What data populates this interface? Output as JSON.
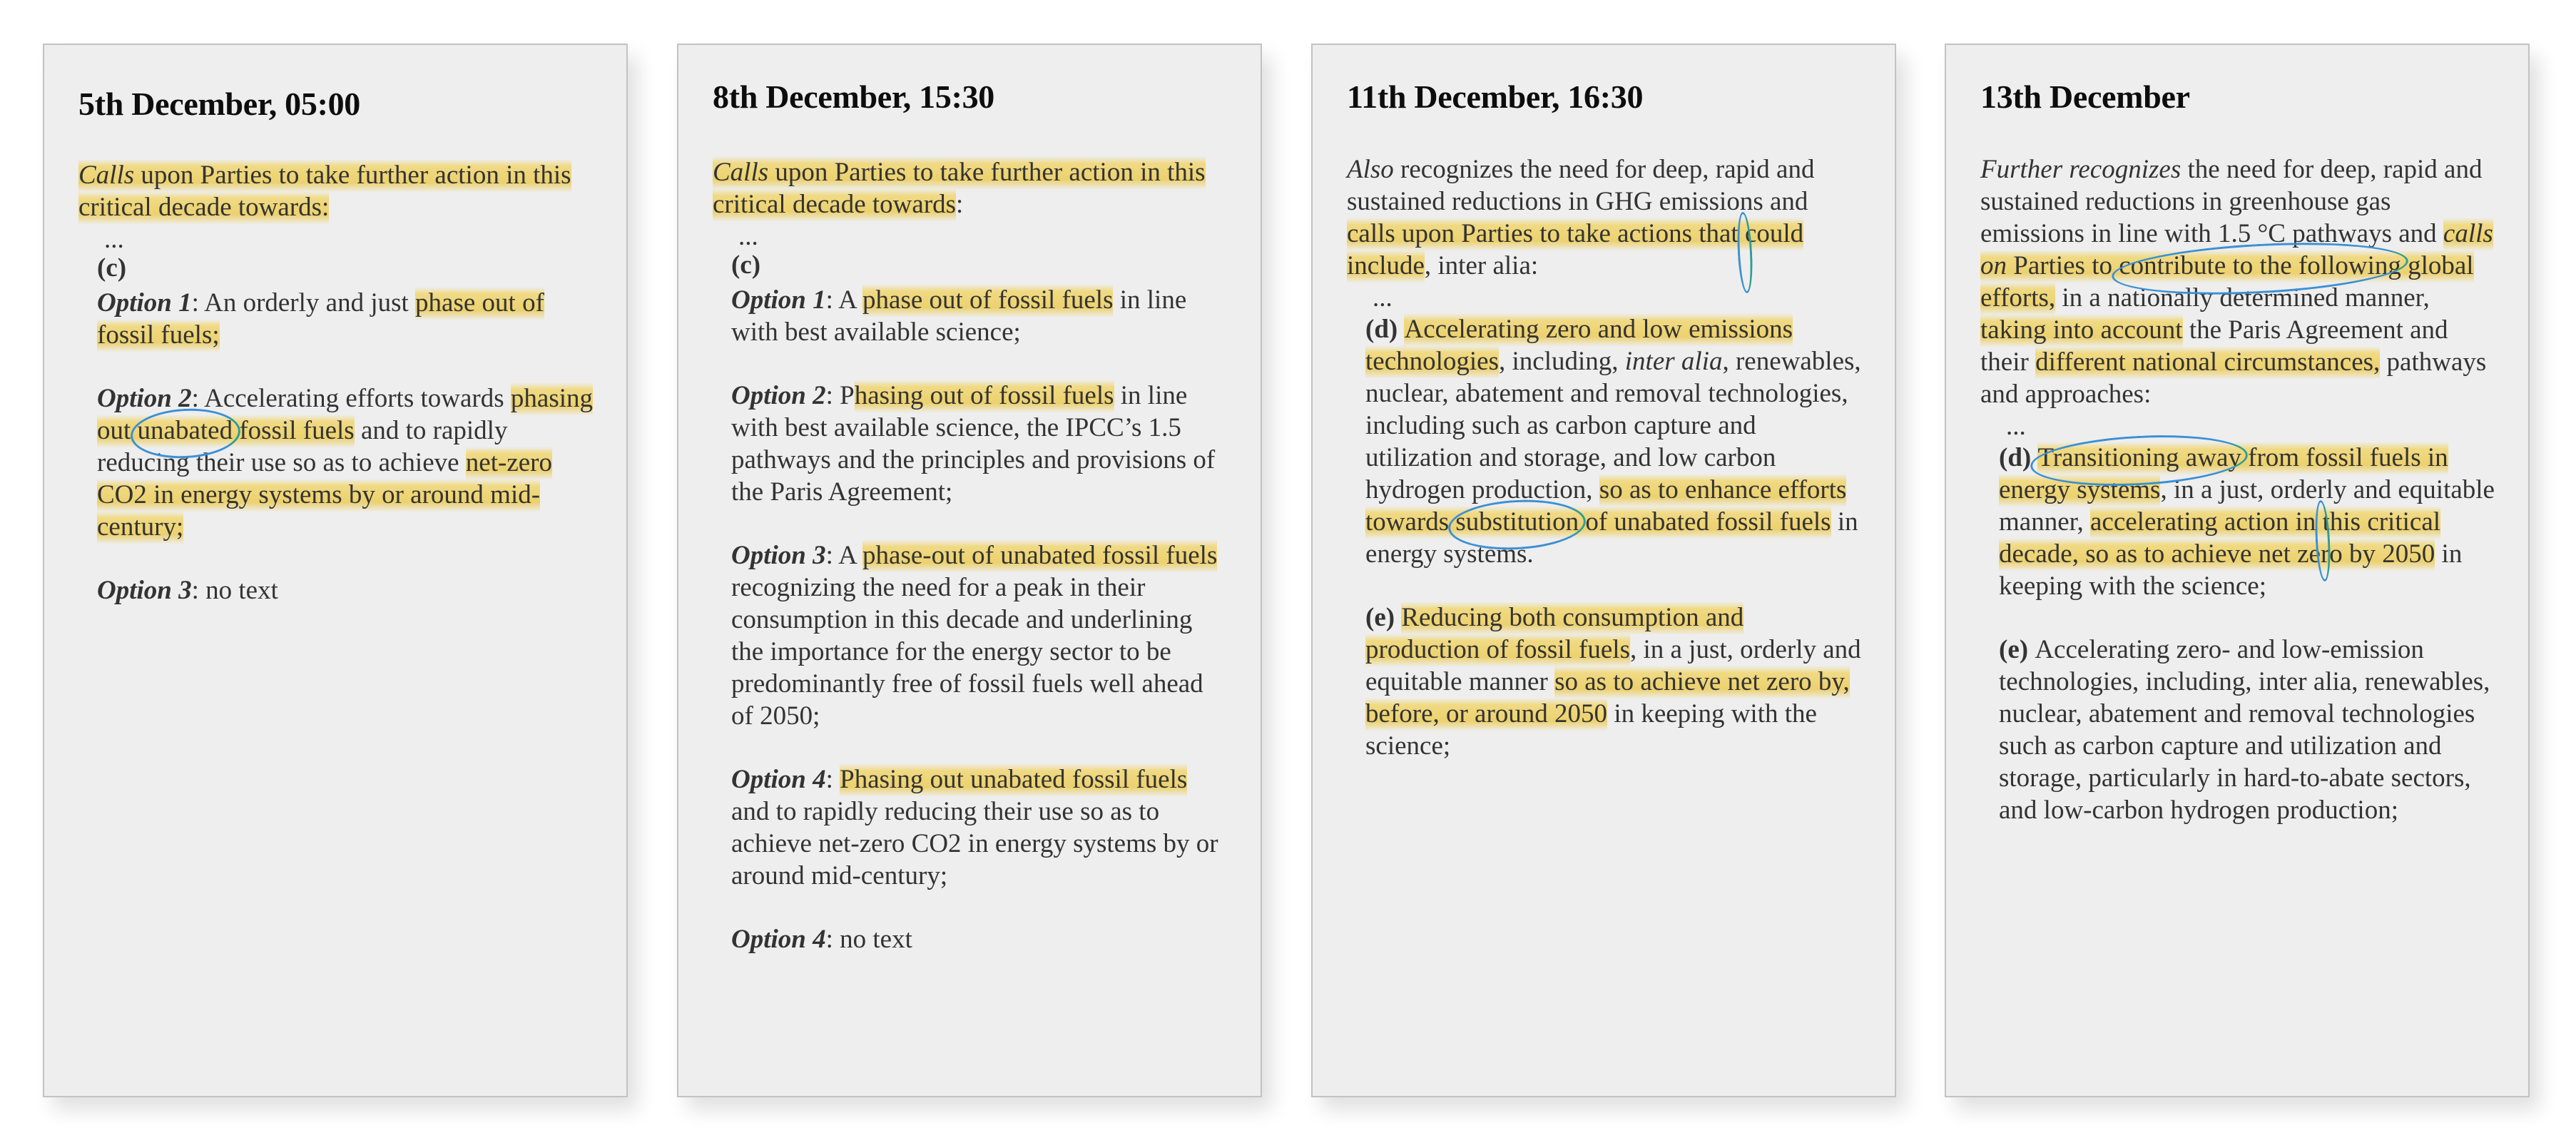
{
  "colors": {
    "card_background": "#eeeeee",
    "highlight": "#f0d670",
    "circle_annotation": "#3a90d4",
    "text": "#333333",
    "title": "#0d0d0d"
  },
  "cards": [
    {
      "title": "5th December, 05:00",
      "paragraphs": [
        {
          "kind": "lead",
          "segments": [
            {
              "t": "Calls",
              "i": true,
              "hl": true
            },
            {
              "t": " upon Parties to take further action in this critical decade towards:",
              "hl": true
            }
          ]
        },
        {
          "kind": "ellipsis",
          "segments": [
            {
              "t": "..."
            }
          ]
        },
        {
          "kind": "label",
          "segments": [
            {
              "t": "(c)",
              "b": true
            }
          ]
        },
        {
          "kind": "item",
          "gap": "s",
          "segments": [
            {
              "t": "Option 1",
              "bi": true
            },
            {
              "t": ": An orderly and just "
            },
            {
              "t": "phase out of fossil fuels;",
              "hl": true
            }
          ]
        },
        {
          "kind": "item",
          "segments": [
            {
              "t": "Option 2",
              "bi": true
            },
            {
              "t": ": Accelerating efforts towards "
            },
            {
              "t": "phasing out ",
              "hl": true
            },
            {
              "t": "unabated",
              "hl": true,
              "circle": true
            },
            {
              "t": " fossil fuels",
              "hl": true
            },
            {
              "t": " and to rapidly reducing their use so as to achieve "
            },
            {
              "t": "net-zero CO2 in energy systems by or around mid-century;",
              "hl": true
            }
          ]
        },
        {
          "kind": "item",
          "segments": [
            {
              "t": "Option 3",
              "bi": true
            },
            {
              "t": ": no text"
            }
          ]
        }
      ]
    },
    {
      "title": "8th December, 15:30",
      "paragraphs": [
        {
          "kind": "lead",
          "segments": [
            {
              "t": "Calls",
              "i": true,
              "hl": true
            },
            {
              "t": " upon Parties to take further action in this critical decade towards",
              "hl": true
            },
            {
              "t": ":"
            }
          ]
        },
        {
          "kind": "ellipsis",
          "segments": [
            {
              "t": "..."
            }
          ]
        },
        {
          "kind": "label",
          "segments": [
            {
              "t": "(c)",
              "b": true
            }
          ]
        },
        {
          "kind": "item",
          "gap": "s",
          "segments": [
            {
              "t": "Option 1",
              "bi": true
            },
            {
              "t": ": A "
            },
            {
              "t": "phase out of fossil fuels",
              "hl": true
            },
            {
              "t": " in line with best available science;"
            }
          ]
        },
        {
          "kind": "item",
          "segments": [
            {
              "t": "Option 2",
              "bi": true
            },
            {
              "t": ": P"
            },
            {
              "t": "hasing out of fossil fuels",
              "hl": true
            },
            {
              "t": " in line with best available science, the IPCC’s 1.5 pathways and the principles and provisions of the Paris Agreement;"
            }
          ]
        },
        {
          "kind": "item",
          "segments": [
            {
              "t": "Option 3",
              "bi": true
            },
            {
              "t": ": A "
            },
            {
              "t": "phase-out of unabated fossil fuels",
              "hl": true
            },
            {
              "t": " recognizing the need for a peak in their consumption in this decade and underlining the importance for the energy sector to be predominantly free of fossil fuels well ahead of 2050;"
            }
          ]
        },
        {
          "kind": "item",
          "segments": [
            {
              "t": "Option 4",
              "bi": true
            },
            {
              "t": ": "
            },
            {
              "t": "Phasing out unabated fossil fuels",
              "hl": true
            },
            {
              "t": " and to rapidly reducing their use so as to achieve net-zero CO2 in energy systems by or around mid-century;"
            }
          ]
        },
        {
          "kind": "item",
          "segments": [
            {
              "t": "Option 4",
              "bi": true
            },
            {
              "t": ": no text"
            }
          ]
        }
      ]
    },
    {
      "title": "11th December, 16:30",
      "paragraphs": [
        {
          "kind": "lead",
          "segments": [
            {
              "t": "Also",
              "i": true
            },
            {
              "t": " recognizes the need for deep, rapid and sustained reductions in GHG emissions and "
            },
            {
              "t": "calls upon Parties to take actions that ",
              "hl": true
            },
            {
              "t": "could include",
              "hl": true,
              "circle": true
            },
            {
              "t": ", inter alia:"
            }
          ]
        },
        {
          "kind": "ellipsis",
          "segments": [
            {
              "t": "..."
            }
          ]
        },
        {
          "kind": "item",
          "gap": "s",
          "segments": [
            {
              "t": "(d) ",
              "b": true
            },
            {
              "t": "Accelerating zero and low emissions technologies",
              "hl": true
            },
            {
              "t": ", including, "
            },
            {
              "t": "inter alia",
              "i": true
            },
            {
              "t": ", renewables, nuclear, abatement and removal technologies, including such as carbon capture and utilization and storage, and low carbon hydrogen production, "
            },
            {
              "t": "so as to enhance efforts towards ",
              "hl": true
            },
            {
              "t": "substitution",
              "hl": true,
              "circle": true
            },
            {
              "t": " of unabated fossil fuels",
              "hl": true
            },
            {
              "t": " in energy systems."
            }
          ]
        },
        {
          "kind": "item",
          "segments": [
            {
              "t": "(e) ",
              "b": true
            },
            {
              "t": "Reducing both consumption and production of fossil fuels",
              "hl": true
            },
            {
              "t": ", in a just, orderly and equitable manner "
            },
            {
              "t": "so as to achieve net zero by, before, or around 2050",
              "hl": true
            },
            {
              "t": " in keeping with the science;"
            }
          ]
        }
      ]
    },
    {
      "title": "13th December",
      "paragraphs": [
        {
          "kind": "lead",
          "segments": [
            {
              "t": "Further recognizes",
              "i": true
            },
            {
              "t": " the need for deep, rapid and sustained reductions in greenhouse gas emissions in line with 1.5 °C pathways and "
            },
            {
              "t": "calls on",
              "i": true,
              "hl": true
            },
            {
              "t": " Parties to ",
              "hl": true
            },
            {
              "t": "contribute to the following",
              "hl": true,
              "circle": true
            },
            {
              "t": " global efforts,",
              "hl": true
            },
            {
              "t": " in a nationally determined manner, "
            },
            {
              "t": "taking into account",
              "hl": true
            },
            {
              "t": " the Paris Agreement and their "
            },
            {
              "t": "different national circumstances,",
              "hl": true
            },
            {
              "t": " pathways and approaches:"
            }
          ]
        },
        {
          "kind": "ellipsis",
          "segments": [
            {
              "t": "..."
            }
          ]
        },
        {
          "kind": "item",
          "gap": "s",
          "segments": [
            {
              "t": "(d) ",
              "b": true
            },
            {
              "t": "Transitioning away",
              "hl": true,
              "circle": true
            },
            {
              "t": " from fossil fuels in energy systems",
              "hl": true
            },
            {
              "t": ", in a just, orderly and equitable manner, "
            },
            {
              "t": "accelerating action in ",
              "hl": true
            },
            {
              "t": "this critical decade,",
              "hl": true,
              "circle": true
            },
            {
              "t": " so as to achieve net zero by 2050",
              "hl": true
            },
            {
              "t": " in keeping with the science;"
            }
          ]
        },
        {
          "kind": "item",
          "segments": [
            {
              "t": "(e) ",
              "b": true
            },
            {
              "t": "Accelerating zero- and low-emission technologies, including, inter alia, renewables, nuclear, abatement and removal technologies such as carbon capture and utilization and storage, particularly in hard-to-abate sectors, and low-carbon hydrogen production;"
            }
          ]
        }
      ]
    }
  ]
}
